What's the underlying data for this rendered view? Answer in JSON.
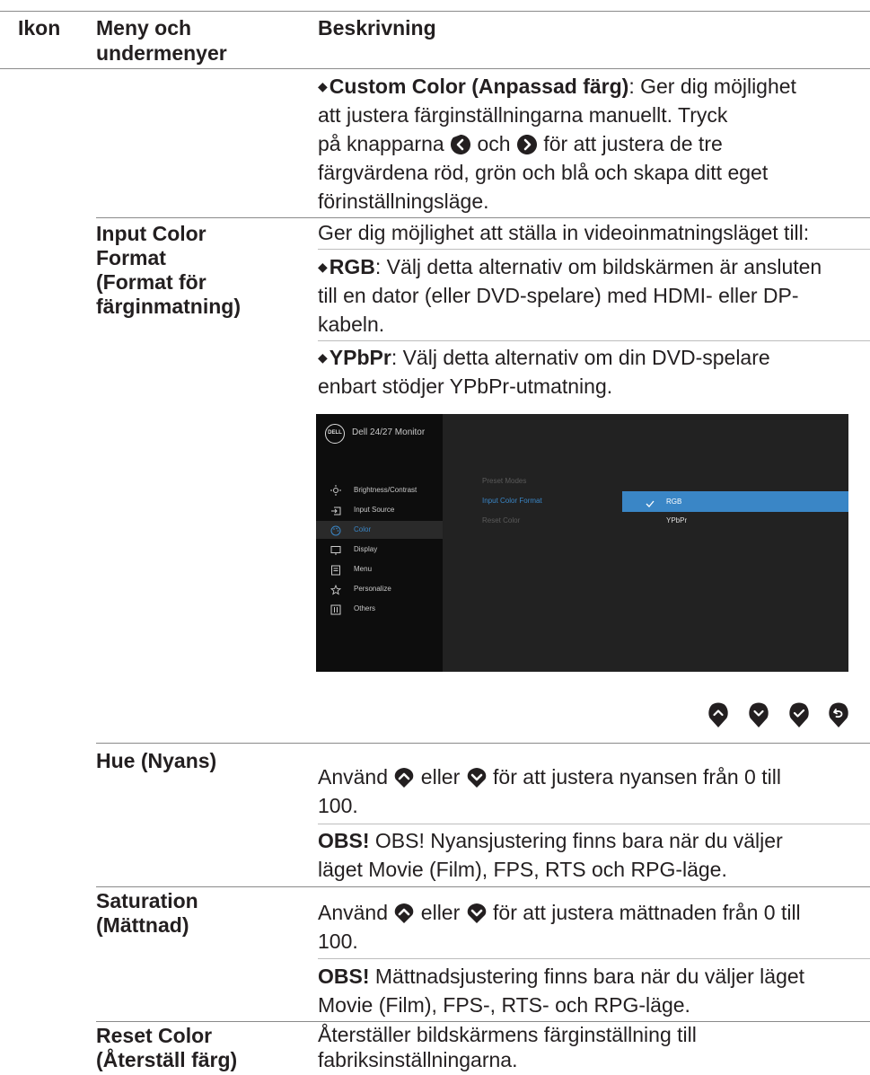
{
  "header": {
    "col_icon": "Ikon",
    "col_menu_line1": "Meny och",
    "col_menu_line2": "undermenyer",
    "col_desc": "Beskrivning"
  },
  "custom_color": {
    "bold": "Custom Color (Anpassad färg)",
    "line1_rest": ": Ger dig möjlighet",
    "line2": "att justera färginställningarna manuellt. Tryck",
    "line3_a": "på knapparna",
    "line3_b": "och",
    "line3_c": "för att justera de tre",
    "line4": "färgvärdena röd, grön och blå och skapa ditt eget",
    "line5": "förinställningsläge."
  },
  "input_color_format": {
    "menu_lines": [
      "Input Color",
      "Format",
      "(Format för",
      "färginmatning)"
    ],
    "intro": "Ger dig möjlighet att ställa in videoinmatningsläget till:",
    "rgb_bold": "RGB",
    "rgb_line1": ": Välj detta alternativ om bildskärmen är ansluten",
    "rgb_line2": "till en dator (eller DVD-spelare) med HDMI- eller DP-",
    "rgb_line3": "kabeln.",
    "ypbpr_bold": "YPbPr",
    "ypbpr_line1": ": Välj detta alternativ om din DVD-spelare",
    "ypbpr_line2": "enbart stödjer YPbPr-utmatning."
  },
  "osd": {
    "logo": "DELL",
    "title": "Dell 24/27 Monitor",
    "menu_items": [
      {
        "label": "Brightness/Contrast",
        "icon": "brightness-icon"
      },
      {
        "label": "Input Source",
        "icon": "input-source-icon"
      },
      {
        "label": "Color",
        "icon": "color-palette-icon",
        "selected": true
      },
      {
        "label": "Display",
        "icon": "display-icon"
      },
      {
        "label": "Menu",
        "icon": "menu-icon"
      },
      {
        "label": "Personalize",
        "icon": "star-icon"
      },
      {
        "label": "Others",
        "icon": "others-icon"
      }
    ],
    "submenu": [
      "Preset Modes",
      "Input Color Format",
      "Reset Color"
    ],
    "options": [
      "RGB",
      "YPbPr"
    ],
    "selected_option": "RGB",
    "accent": "#3a86c6"
  },
  "nav_buttons": [
    "chevron-up-icon",
    "chevron-down-icon",
    "check-icon",
    "back-icon"
  ],
  "hue": {
    "menu": "Hue (Nyans)",
    "line1_a": "Använd",
    "line1_b": "eller",
    "line1_c": "för att justera nyansen från 0 till",
    "line2": "100.",
    "note_bold": "OBS!",
    "note_line1": " OBS! Nyansjustering finns bara när du väljer",
    "note_line2": "läget Movie (Film), FPS, RTS och RPG-läge."
  },
  "saturation": {
    "menu_lines": [
      "Saturation",
      "(Mättnad)"
    ],
    "line1_a": "Använd",
    "line1_b": "eller",
    "line1_c": "för att justera mättnaden från 0 till",
    "line2": "100.",
    "note_bold": "OBS!",
    "note_line1": " Mättnadsjustering finns bara när du väljer läget",
    "note_line2": "Movie (Film), FPS-, RTS- och RPG-läge."
  },
  "reset_color": {
    "menu_lines": [
      "Reset Color",
      "(Återställ färg)"
    ],
    "line1": "Återställer bildskärmens färginställning till",
    "line2": "fabriksinställningarna."
  }
}
